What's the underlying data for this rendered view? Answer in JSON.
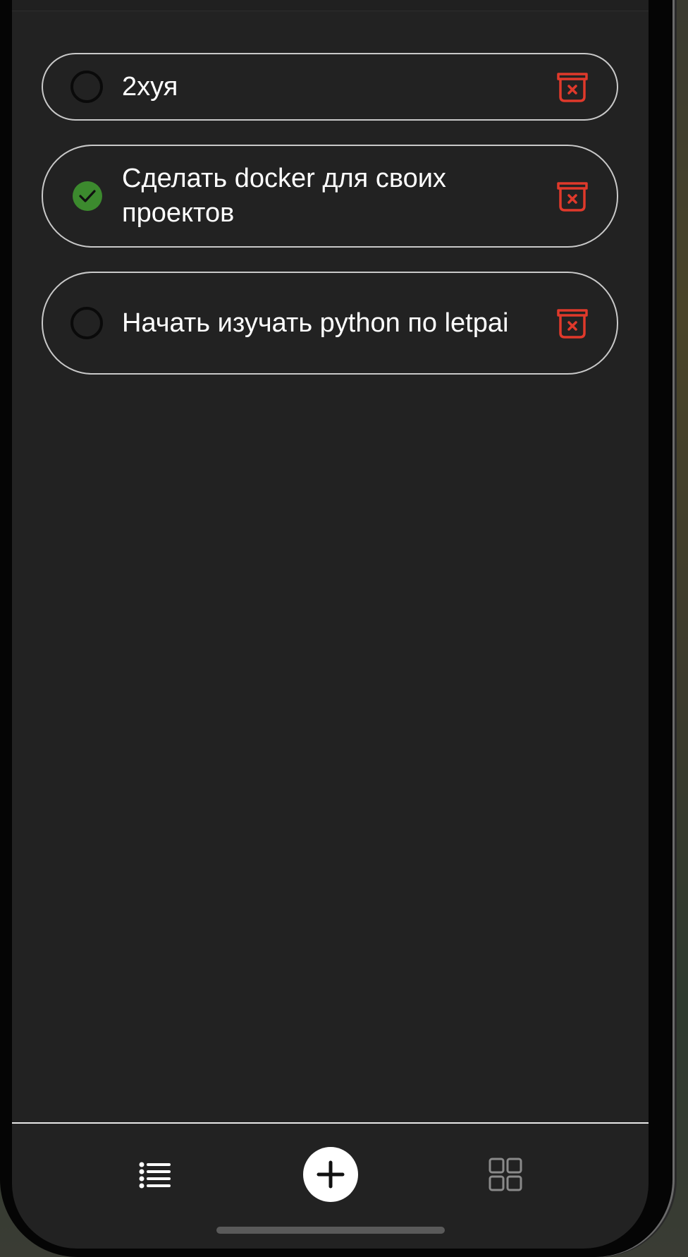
{
  "tasks": [
    {
      "title": "2хуя",
      "completed": false
    },
    {
      "title": "Сделать docker для своих проектов",
      "completed": true
    },
    {
      "title": "Начать изучать python по letpai",
      "completed": false
    }
  ],
  "icons": {
    "check": "check-circle-icon",
    "unchecked": "empty-circle-icon",
    "delete": "trash-icon",
    "tab_list": "list-icon",
    "tab_add": "plus-icon",
    "tab_grid": "grid-icon"
  },
  "colors": {
    "background": "#222222",
    "task_border": "#c9c9c9",
    "done": "#3c8a2e",
    "delete": "#e0392b",
    "text": "#ffffff"
  }
}
